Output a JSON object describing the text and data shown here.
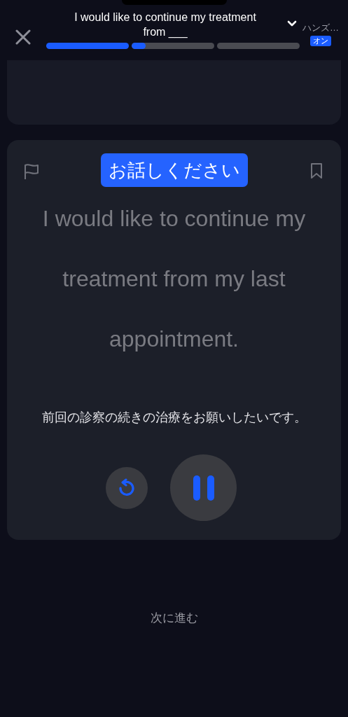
{
  "header": {
    "title": "I would like to continue my treatment from ___",
    "progress": [
      {
        "kind": "done",
        "level": 1
      },
      {
        "kind": "current",
        "level": 0.17
      },
      {
        "kind": "upcoming"
      }
    ],
    "hands_free": {
      "label": "ハンズ…",
      "badge": "オン",
      "on": true
    }
  },
  "card": {
    "prompt": "お話しください",
    "sentence": "I would like to continue my treatment from my last appointment.",
    "translation": "前回の診察の続きの治療をお願いしたいです。",
    "playing": true
  },
  "next_label": "次に進む"
}
